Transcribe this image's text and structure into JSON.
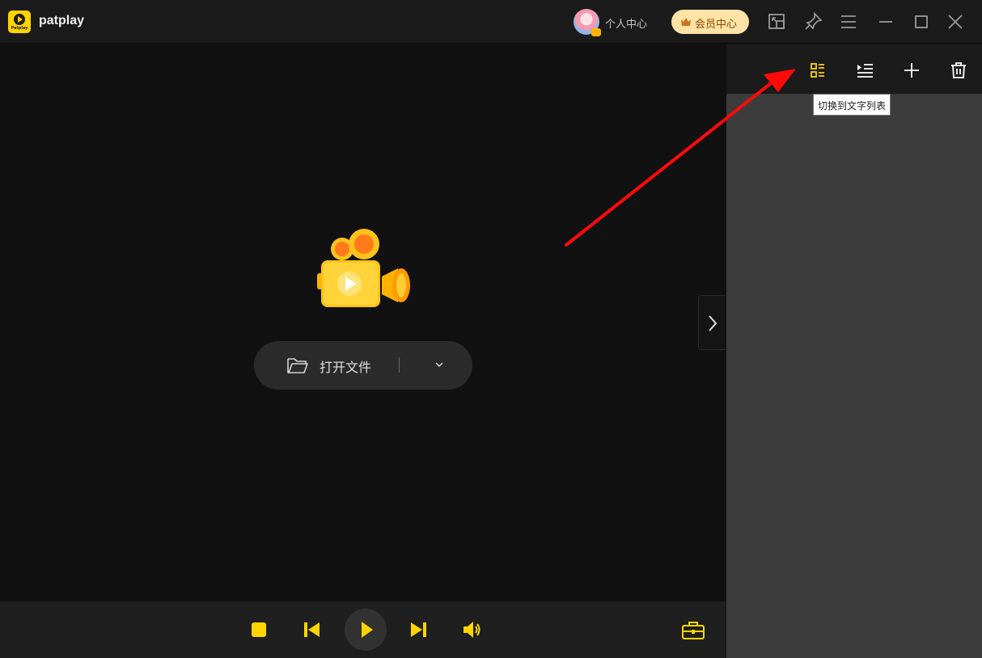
{
  "app": {
    "name": "patplay",
    "logo_text": "Patplay"
  },
  "titlebar": {
    "user_center_label": "个人中心",
    "vip_label": "会员中心",
    "icons": [
      "mini-player-icon",
      "pin-icon",
      "menu-icon",
      "minimize-icon",
      "maximize-icon",
      "close-icon"
    ]
  },
  "player": {
    "open_file_label": "打开文件"
  },
  "playlist": {
    "toolbar_icons": [
      "list-view-icon",
      "play-order-icon",
      "add-icon",
      "delete-icon"
    ],
    "tooltip": "切换到文字列表"
  },
  "controls": {
    "icons": [
      "stop-icon",
      "previous-icon",
      "play-icon",
      "next-icon",
      "volume-icon",
      "toolbox-icon"
    ]
  },
  "colors": {
    "accent": "#ffd400",
    "background": "#111111",
    "sidebar": "#3c3c3c",
    "annotation_arrow": "#ff0000"
  }
}
